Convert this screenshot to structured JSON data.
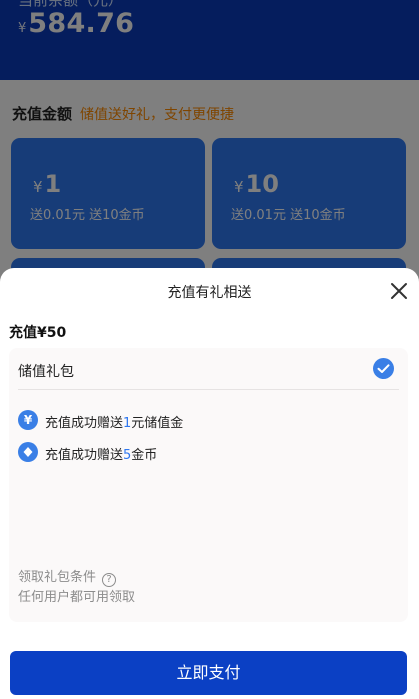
{
  "header": {
    "balance_label": "当前余额（元）",
    "currency": "¥",
    "balance": "584.76"
  },
  "recharge_section": {
    "title": "充值金额",
    "subtitle": "储值送好礼，支付更便捷"
  },
  "amount_options": [
    {
      "currency": "¥",
      "amount": "1",
      "bonus": "送0.01元 送10金币"
    },
    {
      "currency": "¥",
      "amount": "10",
      "bonus": "送0.01元 送10金币"
    }
  ],
  "sheet": {
    "title": "充值有礼相送",
    "close_icon": "close-icon",
    "recharge_prefix": "充值",
    "recharge_currency": "¥",
    "recharge_amount": "50",
    "gift_package": {
      "name": "储值礼包",
      "selected": true,
      "benefits": [
        {
          "icon": "yuan-icon",
          "prefix": "充值成功赠送",
          "value": "1",
          "suffix": "元储值金"
        },
        {
          "icon": "coin-icon",
          "prefix": "充值成功赠送",
          "value": "5",
          "suffix": "金币"
        }
      ],
      "condition_label": "领取礼包条件",
      "condition_text": "任何用户都可用领取"
    },
    "pay_button": "立即支付"
  },
  "colors": {
    "header_blue": "#0a3bbb",
    "card_blue": "#2f78f0",
    "accent_orange": "#ff8a00",
    "pay_blue": "#0b40c4",
    "check_blue": "#3a7fe6"
  }
}
